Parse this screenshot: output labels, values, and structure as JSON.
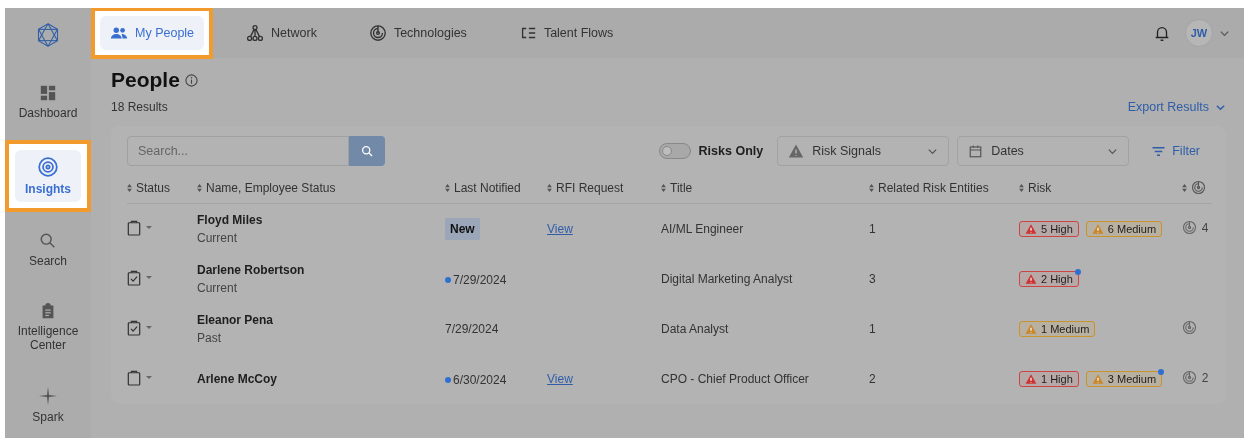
{
  "sidebar": {
    "items": [
      {
        "label": "Dashboard",
        "kind": "dashboard",
        "selected": false,
        "highlighted": false
      },
      {
        "label": "Insights",
        "kind": "insights",
        "selected": true,
        "highlighted": true
      },
      {
        "label": "Search",
        "kind": "search",
        "selected": false,
        "highlighted": false
      },
      {
        "label": "Intelligence Center",
        "kind": "intelligence",
        "selected": false,
        "highlighted": false
      },
      {
        "label": "Spark",
        "kind": "spark",
        "selected": false,
        "highlighted": false
      }
    ]
  },
  "tabs": [
    {
      "label": "My People",
      "kind": "people",
      "selected": true,
      "highlighted": true
    },
    {
      "label": "Network",
      "kind": "network",
      "selected": false,
      "highlighted": false
    },
    {
      "label": "Technologies",
      "kind": "technologies",
      "selected": false,
      "highlighted": false
    },
    {
      "label": "Talent Flows",
      "kind": "flows",
      "selected": false,
      "highlighted": false
    }
  ],
  "user": {
    "initials": "JW"
  },
  "page": {
    "title": "People",
    "results": "18 Results",
    "export": "Export Results"
  },
  "toolbar": {
    "search_placeholder": "Search...",
    "risks_only": {
      "label": "Risks Only",
      "on": false
    },
    "risk_signals": "Risk Signals",
    "dates": "Dates",
    "filter": "Filter"
  },
  "table": {
    "columns": [
      {
        "kind": "text",
        "label": "Status"
      },
      {
        "kind": "text",
        "label": "Name, Employee Status"
      },
      {
        "kind": "text",
        "label": "Last Notified"
      },
      {
        "kind": "text",
        "label": "RFI Request"
      },
      {
        "kind": "text",
        "label": "Title"
      },
      {
        "kind": "text",
        "label": "Related Risk Entities"
      },
      {
        "kind": "text",
        "label": "Risk"
      },
      {
        "kind": "icon"
      }
    ],
    "rows": [
      {
        "checked": false,
        "name": "Floyd Miles",
        "employee_status": "Current",
        "notified": {
          "kind": "new",
          "text": "New",
          "unread": false
        },
        "rfi": "View",
        "title": "AI/ML Engineer",
        "related": "1",
        "risks": [
          {
            "kind": "high",
            "label": "5 High",
            "unread": false
          },
          {
            "kind": "medium",
            "label": "6 Medium",
            "unread": false
          }
        ],
        "technology": {
          "count": "4"
        }
      },
      {
        "checked": true,
        "name": "Darlene Robertson",
        "employee_status": "Current",
        "notified": {
          "kind": "date",
          "text": "7/29/2024",
          "unread": true
        },
        "title": "Digital Marketing Analyst",
        "related": "3",
        "risks": [
          {
            "kind": "high",
            "label": "2 High",
            "unread": true
          }
        ]
      },
      {
        "checked": true,
        "name": "Eleanor Pena",
        "employee_status": "Past",
        "notified": {
          "kind": "date",
          "text": "7/29/2024",
          "unread": false
        },
        "title": "Data Analyst",
        "related": "1",
        "risks": [
          {
            "kind": "medium",
            "label": "1 Medium",
            "unread": false
          }
        ],
        "technology": {}
      },
      {
        "checked": false,
        "name": "Arlene McCoy",
        "notified": {
          "kind": "date",
          "text": "6/30/2024",
          "unread": true
        },
        "rfi": "View",
        "title": "CPO - Chief Product Officer",
        "related": "2",
        "risks": [
          {
            "kind": "high",
            "label": "1 High",
            "unread": false
          },
          {
            "kind": "medium",
            "label": "3 Medium",
            "unread": true
          }
        ],
        "technology": {
          "count": "2"
        }
      }
    ]
  }
}
